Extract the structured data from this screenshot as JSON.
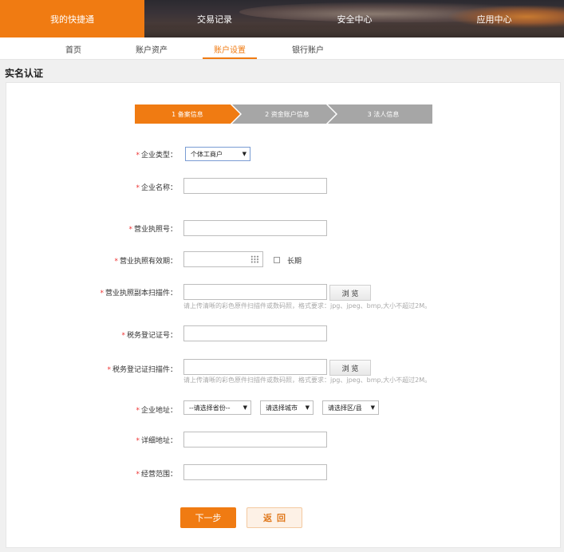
{
  "top_nav": {
    "items": [
      {
        "label": "我的快捷通",
        "active": true
      },
      {
        "label": "交易记录",
        "active": false
      },
      {
        "label": "安全中心",
        "active": false
      },
      {
        "label": "应用中心",
        "active": false
      }
    ]
  },
  "sub_nav": {
    "items": [
      {
        "label": "首页",
        "active": false
      },
      {
        "label": "账户资产",
        "active": false
      },
      {
        "label": "账户设置",
        "active": true
      },
      {
        "label": "银行账户",
        "active": false
      }
    ]
  },
  "page_title": "实名认证",
  "steps": [
    {
      "label": "1 备案信息",
      "active": true
    },
    {
      "label": "2 资金账户信息",
      "active": false
    },
    {
      "label": "3 法人信息",
      "active": false
    }
  ],
  "form": {
    "required_mark": "*",
    "company_type": {
      "label": "企业类型：",
      "value": "个体工商户"
    },
    "company_name": {
      "label": "企业名称：",
      "value": ""
    },
    "license_no": {
      "label": "营业执照号：",
      "value": ""
    },
    "license_validity": {
      "label": "营业执照有效期：",
      "value": "",
      "long_term_label": "长期",
      "long_term_checked": false
    },
    "license_scan": {
      "label": "营业执照副本扫描件：",
      "value": "",
      "browse_label": "浏 览",
      "hint": "请上传清晰的彩色原件扫描件或数码照，格式要求：jpg、jpeg、bmp,大小不超过2M。"
    },
    "tax_no": {
      "label": "税务登记证号：",
      "value": ""
    },
    "tax_scan": {
      "label": "税务登记证扫描件：",
      "value": "",
      "browse_label": "浏 览",
      "hint": "请上传清晰的彩色原件扫描件或数码照，格式要求：jpg、jpeg、bmp,大小不超过2M。"
    },
    "address": {
      "label": "企业地址：",
      "province": "--请选择省份--",
      "city": "请选择城市",
      "district": "请选择区/县"
    },
    "detail_address": {
      "label": "详细地址：",
      "value": ""
    },
    "business_scope": {
      "label": "经营范围：",
      "value": ""
    }
  },
  "buttons": {
    "next": "下一步",
    "back": "返回"
  }
}
